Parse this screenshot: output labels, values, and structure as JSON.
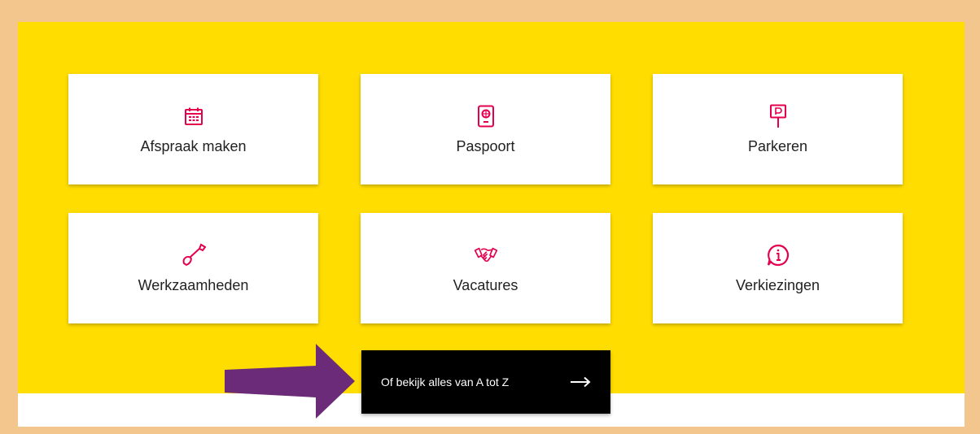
{
  "colors": {
    "accent": "#E4004F",
    "panel": "#FFDD00",
    "cta_background": "#000000",
    "annotation_arrow": "#6B2B79",
    "frame": "#F3C68E"
  },
  "tiles": [
    {
      "label": "Afspraak maken",
      "icon": "calendar-icon"
    },
    {
      "label": "Paspoort",
      "icon": "passport-icon"
    },
    {
      "label": "Parkeren",
      "icon": "parking-sign-icon"
    },
    {
      "label": "Werkzaamheden",
      "icon": "shovel-icon"
    },
    {
      "label": "Vacatures",
      "icon": "handshake-icon"
    },
    {
      "label": "Verkiezingen",
      "icon": "info-bubble-icon"
    }
  ],
  "cta": {
    "label": "Of bekijk alles van A tot Z",
    "icon": "arrow-right-icon"
  },
  "annotation": {
    "icon": "purple-pointer-arrow"
  }
}
